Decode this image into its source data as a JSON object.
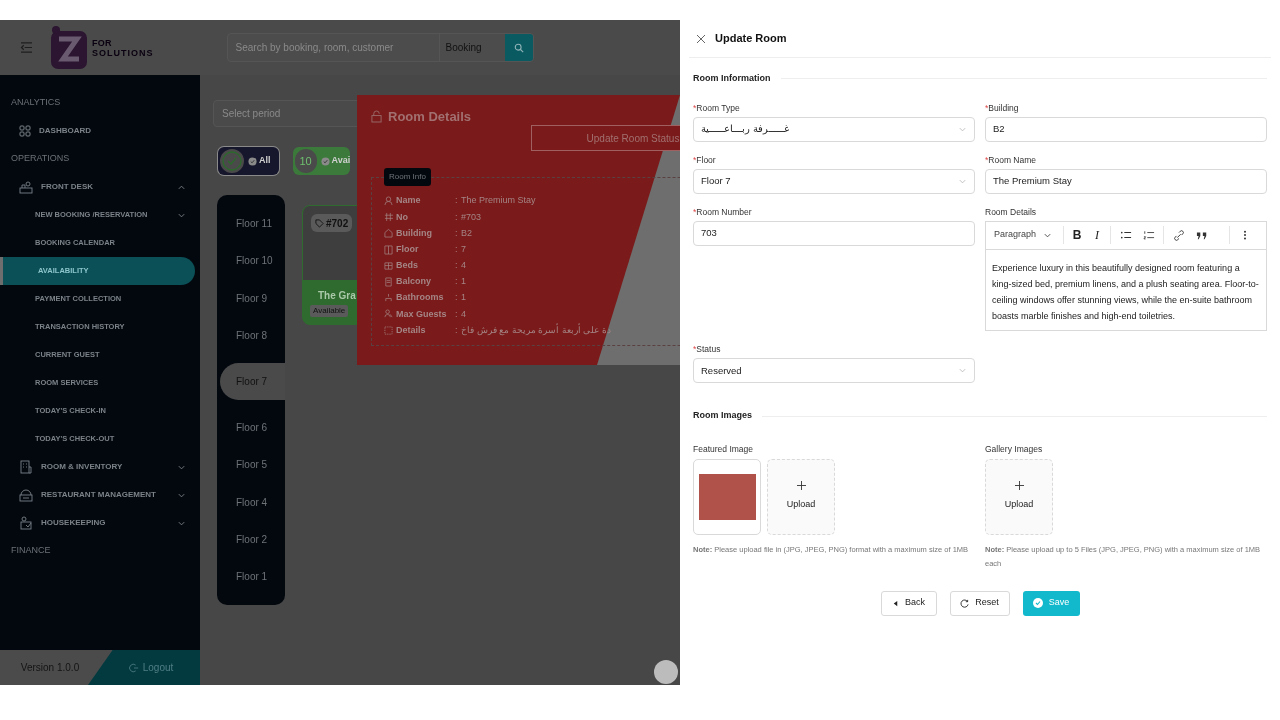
{
  "header": {
    "logo_line1": "FOR",
    "logo_line2": "SOLUTIONS",
    "search_placeholder": "Search by booking, room, customer",
    "search_scope": "Booking"
  },
  "sidebar": {
    "groups": [
      {
        "heading": "ANALYTICS",
        "items": [
          {
            "label": "DASHBOARD",
            "selected": false
          }
        ]
      },
      {
        "heading": "OPERATIONS",
        "items": [
          {
            "label": "FRONT DESK",
            "selected": false,
            "expanded": true,
            "children": [
              {
                "label": "NEW BOOKING /RESERVATION",
                "selected": false,
                "expanded": false
              },
              {
                "label": "BOOKING CALENDAR",
                "selected": false
              },
              {
                "label": "AVAILABILITY",
                "selected": true
              },
              {
                "label": "PAYMENT COLLECTION",
                "selected": false
              },
              {
                "label": "TRANSACTION HISTORY",
                "selected": false
              },
              {
                "label": "CURRENT GUEST",
                "selected": false
              },
              {
                "label": "ROOM SERVICES",
                "selected": false
              },
              {
                "label": "TODAY'S CHECK-IN",
                "selected": false
              },
              {
                "label": "TODAY'S CHECK-OUT",
                "selected": false
              }
            ]
          },
          {
            "label": "ROOM & INVENTORY",
            "selected": false,
            "expanded": false
          },
          {
            "label": "RESTAURANT MANAGEMENT",
            "selected": false,
            "expanded": false
          },
          {
            "label": "HOUSEKEEPING",
            "selected": false,
            "expanded": false
          }
        ]
      },
      {
        "heading": "FINANCE"
      }
    ],
    "version": "Version 1.0.0",
    "logout": "Logout"
  },
  "main": {
    "period_placeholder": "Select period",
    "filters": [
      {
        "kind": "all",
        "label": "All",
        "selected": true,
        "color": "#16162c"
      },
      {
        "kind": "count",
        "count": "10",
        "label": "Avai",
        "selected": false,
        "color": "#3b7a3b"
      }
    ],
    "floors": [
      {
        "label": "Floor 11",
        "selected": false
      },
      {
        "label": "Floor 10",
        "selected": false
      },
      {
        "label": "Floor 9",
        "selected": false
      },
      {
        "label": "Floor 8",
        "selected": false
      },
      {
        "label": "Floor 7",
        "selected": true
      },
      {
        "label": "Floor 6",
        "selected": false
      },
      {
        "label": "Floor 5",
        "selected": false
      },
      {
        "label": "Floor 4",
        "selected": false
      },
      {
        "label": "Floor 2",
        "selected": false
      },
      {
        "label": "Floor 1",
        "selected": false
      }
    ],
    "room_card": {
      "number": "#702",
      "name": "The Gra",
      "status": "Available"
    }
  },
  "room_details": {
    "title": "Room Details",
    "update_button": "Update Room Status",
    "info_badge": "Room Info",
    "rows": [
      {
        "label": "Name",
        "separator": ":",
        "value": "The Premium Stay"
      },
      {
        "label": "No",
        "separator": ":",
        "value": "#703"
      },
      {
        "label": "Building",
        "separator": ":",
        "value": "B2"
      },
      {
        "label": "Floor",
        "separator": ":",
        "value": "7"
      },
      {
        "label": "Beds",
        "separator": ":",
        "value": "4"
      },
      {
        "label": "Balcony",
        "separator": ":",
        "value": "1"
      },
      {
        "label": "Bathrooms",
        "separator": ":",
        "value": "1"
      },
      {
        "label": "Max Guests",
        "separator": ":",
        "value": "4"
      },
      {
        "label": "Details",
        "separator": ":",
        "value": "دة على أربعة أسرة مريحة مع فرش  فاخ"
      }
    ]
  },
  "drawer": {
    "title": "Update Room",
    "info_title": "Room Information",
    "fields": [
      {
        "kind": "select",
        "required_mark": "*",
        "label": "Room Type",
        "value": "غـــــرفة ربـــاعـــــية"
      },
      {
        "kind": "text",
        "required_mark": "*",
        "label": "Building",
        "value": "B2"
      },
      {
        "kind": "select",
        "required_mark": "*",
        "label": "Floor",
        "value": "Floor 7"
      },
      {
        "kind": "text",
        "required_mark": "*",
        "label": "Room Name",
        "value": "The Premium Stay"
      },
      {
        "kind": "text",
        "required_mark": "*",
        "label": "Room Number",
        "value": "703"
      },
      {
        "kind": "editor",
        "label": "Room Details",
        "block_style": "Paragraph",
        "bold_mark": "B",
        "italic_mark": "I",
        "value": "Experience luxury in this beautifully designed room featuring a king-sized bed, premium linens, and a plush seating area. Floor-to-ceiling windows offer stunning views, while the en-suite bathroom boasts marble finishes and high-end toiletries."
      },
      {
        "kind": "select",
        "required_mark": "*",
        "label": "Status",
        "value": "Reserved"
      }
    ],
    "images_title": "Room Images",
    "featured": {
      "label": "Featured Image",
      "upload": "Upload",
      "note": "**Note:** Please upload file in (JPG, JPEG, PNG) format with a maximum size of 1MB"
    },
    "gallery": {
      "label": "Gallery Images",
      "upload": "Upload",
      "note": "**Note:** Please upload up to 5 Files (JPG, JPEG, PNG) with a maximum size of 1MB each"
    },
    "buttons": [
      {
        "kind": "back",
        "label": "Back"
      },
      {
        "kind": "reset",
        "label": "Reset"
      },
      {
        "kind": "save",
        "label": "Save"
      }
    ]
  }
}
